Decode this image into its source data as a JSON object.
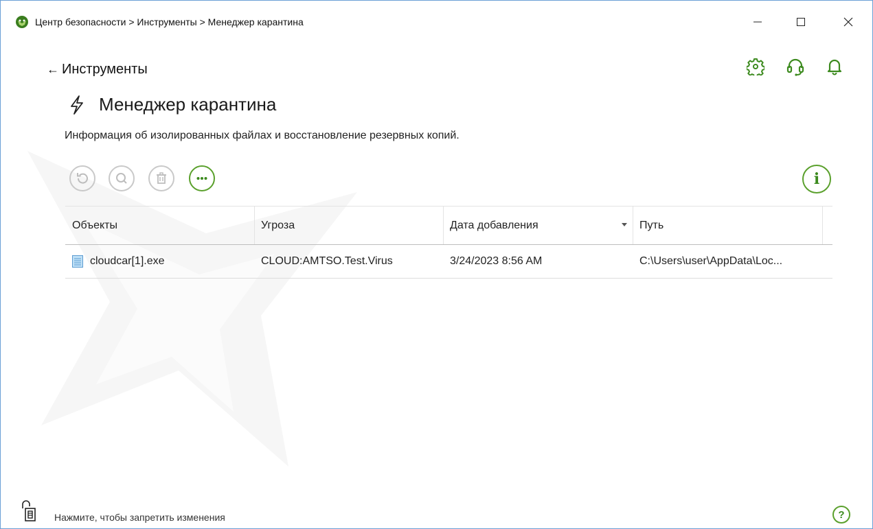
{
  "window": {
    "title": "Центр безопасности > Инструменты > Менеджер карантина",
    "minimize_glyph": "—",
    "maximize_glyph": "☐",
    "close_glyph": "✕"
  },
  "header_icons": [
    "gear-icon",
    "headset-icon",
    "bell-icon"
  ],
  "back": {
    "arrow": "←",
    "label": "Инструменты"
  },
  "page": {
    "title": "Менеджер карантина",
    "title_icon": "lightning-icon",
    "description": "Информация об изолированных файлах и восстановление резервных копий."
  },
  "toolbar": {
    "buttons": [
      {
        "icon": "restore-icon",
        "enabled": false
      },
      {
        "icon": "scan-icon",
        "enabled": false
      },
      {
        "icon": "delete-icon",
        "enabled": false
      },
      {
        "icon": "more-icon",
        "enabled": true
      }
    ],
    "info_label": "i"
  },
  "table": {
    "columns": [
      "Объекты",
      "Угроза",
      "Дата добавления",
      "Путь"
    ],
    "sorted_column": "Дата добавления",
    "rows": [
      {
        "object": "cloudcar[1].exe",
        "threat": "CLOUD:AMTSO.Test.Virus",
        "date": "3/24/2023 8:56 AM",
        "path": "C:\\Users\\user\\AppData\\Loc..."
      }
    ]
  },
  "footer": {
    "lock_text": "Нажмите, чтобы запретить изменения",
    "help_label": "?"
  },
  "colors": {
    "accent_green": "#5aa02c",
    "disabled_gray": "#c9c9c9",
    "window_border": "#6a9fd6"
  }
}
